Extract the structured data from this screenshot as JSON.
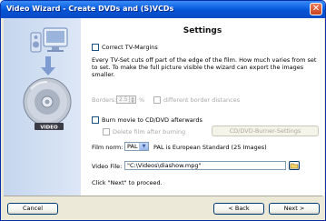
{
  "window": {
    "title": "Video Wizard - Create DVDs and (S)VCDs"
  },
  "left_panel": {
    "badge": "VIDEO"
  },
  "settings": {
    "heading": "Settings",
    "correct_margins_label": "Correct TV-Margins",
    "description": "Every TV-Set cuts off part of the edge of the film. How much varies from set to set. To make the full picture visible the wizard can export the images smaller.",
    "borders_label": "Borders:",
    "borders_value": "2.5",
    "borders_unit": "%",
    "different_borders_label": "different border distances",
    "burn_label": "Burn movie to CD/DVD afterwards",
    "delete_label": "Delete film after burning",
    "burner_settings_button": "CD/DVD-Burner-Settings",
    "film_norm_label": "Film norm:",
    "film_norm_value": "PAL",
    "film_norm_description": "PAL is European Standard (25 Images)",
    "video_file_label": "Video File:",
    "video_file_value": "\"C:\\Videos\\diashow.mpg\"",
    "proceed_text": "Click \"Next\" to proceed."
  },
  "buttons": {
    "cancel": "Cancel",
    "back": "< Back",
    "next": "Next >"
  }
}
